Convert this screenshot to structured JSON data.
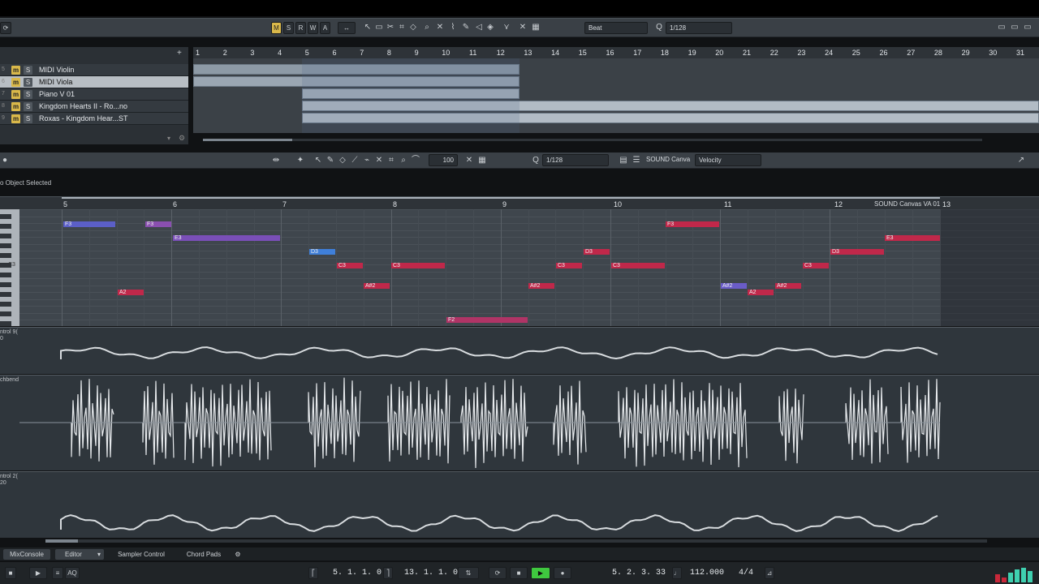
{
  "toolbar": {
    "m": "M",
    "s": "S",
    "r": "R",
    "w": "W",
    "a": "A",
    "grid_type": "Beat",
    "quantize_label": "Q",
    "quantize_value": "1/128"
  },
  "tracks": [
    {
      "num": "5",
      "mute": "m",
      "solo": "S",
      "name": "MIDI Violin",
      "selected": false
    },
    {
      "num": "6",
      "mute": "m",
      "solo": "S",
      "name": "MIDI Viola",
      "selected": true
    },
    {
      "num": "7",
      "mute": "m",
      "solo": "S",
      "name": "Piano V 01",
      "selected": false
    },
    {
      "num": "8",
      "mute": "m",
      "solo": "S",
      "name": "Kingdom Hearts II - Ro...no",
      "selected": false
    },
    {
      "num": "9",
      "mute": "m",
      "solo": "S",
      "name": "Roxas - Kingdom Hear...ST",
      "selected": false
    }
  ],
  "ruler_top": [
    "1",
    "2",
    "3",
    "4",
    "5",
    "6",
    "7",
    "8",
    "9",
    "10",
    "11",
    "12",
    "13",
    "14",
    "15",
    "16",
    "17",
    "18",
    "19",
    "20",
    "21",
    "22",
    "23",
    "24",
    "25",
    "26",
    "27",
    "28",
    "29",
    "30",
    "31"
  ],
  "editor": {
    "velocity_value": "100",
    "quantize_label": "Q",
    "quantize_value": "1/128",
    "instrument": "SOUND Canva",
    "lane_param": "Velocity",
    "info": "o Object Selected",
    "part_label": "SOUND Canvas VA 01"
  },
  "ruler_editor": [
    "5",
    "6",
    "7",
    "8",
    "9",
    "10",
    "11",
    "12",
    "13"
  ],
  "key_label": "C3",
  "notes": [
    {
      "label": "F3",
      "color": "#5b5fc7"
    },
    {
      "label": "F3",
      "color": "#8a4fb0"
    },
    {
      "label": "E3",
      "color": "#7a4fb8"
    },
    {
      "label": "D3",
      "color": "#3f7fd9"
    },
    {
      "label": "C3",
      "color": "#c0284a"
    },
    {
      "label": "C3",
      "color": "#c0284a"
    },
    {
      "label": "A2",
      "color": "#c0284a"
    },
    {
      "label": "A#2",
      "color": "#c0284a"
    },
    {
      "label": "F2",
      "color": "#b03466"
    },
    {
      "label": "A#2",
      "color": "#c0284a"
    },
    {
      "label": "C3",
      "color": "#c0284a"
    },
    {
      "label": "D3",
      "color": "#c0284a"
    },
    {
      "label": "C3",
      "color": "#c0284a"
    },
    {
      "label": "F3",
      "color": "#c0284a"
    },
    {
      "label": "A#2",
      "color": "#6a5cc8"
    },
    {
      "label": "A2",
      "color": "#c0284a"
    },
    {
      "label": "A#2",
      "color": "#c0284a"
    },
    {
      "label": "C3",
      "color": "#c0284a"
    },
    {
      "label": "D3",
      "color": "#c0284a"
    },
    {
      "label": "E3",
      "color": "#c0284a"
    }
  ],
  "lanes": {
    "control1_label": "ntrol 9(",
    "control1_sub": "0",
    "pitchbend_label": "chbend",
    "control2_label": "ntrol 2(",
    "control2_sub": "20"
  },
  "bottom_tabs": {
    "mixconsole": "MixConsole",
    "editor": "Editor",
    "sampler": "Sampler Control",
    "chordpads": "Chord Pads"
  },
  "transport": {
    "left_locator": "5. 1. 1.   0",
    "right_locator": "13. 1. 1.   0",
    "position": "5. 2. 3. 33",
    "tempo": "112.000",
    "signature": "4/4",
    "aq": "AQ"
  },
  "colors": {
    "accent_yellow": "#d9b84a",
    "play_green": "#3fc83f",
    "note_red": "#c0284a"
  }
}
